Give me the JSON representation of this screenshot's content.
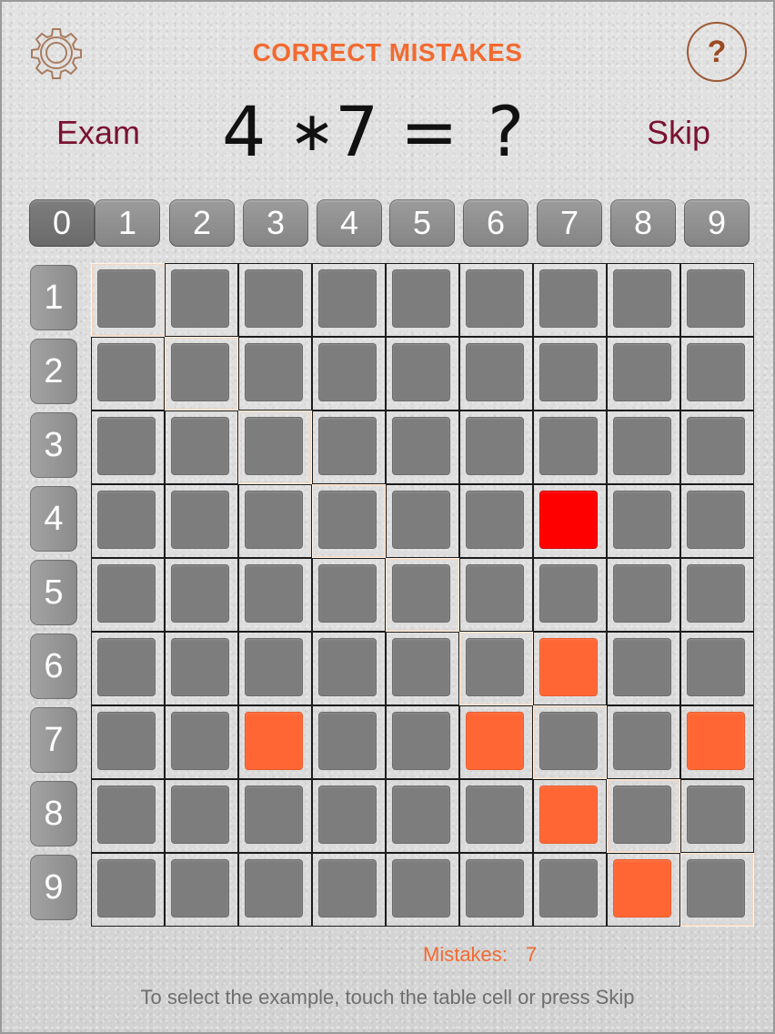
{
  "header": {
    "title": "CORRECT MISTAKES",
    "help_label": "?",
    "exam_label": "Exam",
    "skip_label": "Skip"
  },
  "problem": {
    "a": "4",
    "op": "∗",
    "b": "7",
    "eq": "=",
    "answer": "?"
  },
  "column_headers": [
    "0",
    "1",
    "2",
    "3",
    "4",
    "5",
    "6",
    "7",
    "8",
    "9"
  ],
  "row_headers": [
    "1",
    "2",
    "3",
    "4",
    "5",
    "6",
    "7",
    "8",
    "9"
  ],
  "grid": {
    "size": 9,
    "diagonal_highlighted": true,
    "current_cell": {
      "row": 4,
      "col": 7
    },
    "wrong_cells": [
      {
        "row": 6,
        "col": 7
      },
      {
        "row": 7,
        "col": 3
      },
      {
        "row": 7,
        "col": 6
      },
      {
        "row": 7,
        "col": 9
      },
      {
        "row": 8,
        "col": 7
      },
      {
        "row": 9,
        "col": 8
      }
    ]
  },
  "footer": {
    "mistakes_label": "Mistakes:",
    "mistakes_count": "7",
    "hint": "To select the example, touch the table cell or press Skip"
  },
  "colors": {
    "title": "#f26a30",
    "link": "#7a1232",
    "wrong_cell": "#ff6633",
    "current_cell": "#ff0000",
    "empty_cell": "#7d7d7d",
    "diagonal_border": "#fff3e8"
  },
  "icons": {
    "settings": "gear-icon",
    "help": "help-icon"
  }
}
